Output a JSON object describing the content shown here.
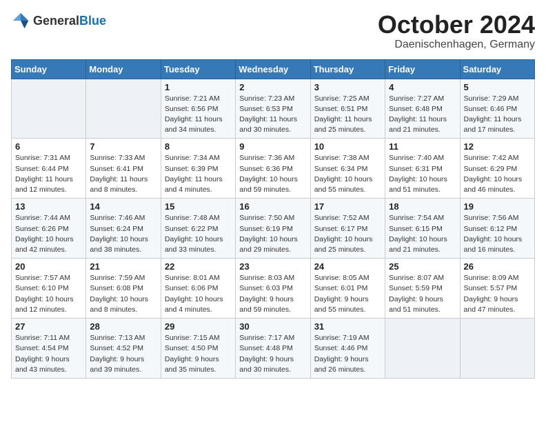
{
  "header": {
    "logo_general": "General",
    "logo_blue": "Blue",
    "month": "October 2024",
    "location": "Daenischenhagen, Germany"
  },
  "weekdays": [
    "Sunday",
    "Monday",
    "Tuesday",
    "Wednesday",
    "Thursday",
    "Friday",
    "Saturday"
  ],
  "weeks": [
    [
      {
        "day": "",
        "info": ""
      },
      {
        "day": "",
        "info": ""
      },
      {
        "day": "1",
        "info": "Sunrise: 7:21 AM\nSunset: 6:56 PM\nDaylight: 11 hours\nand 34 minutes."
      },
      {
        "day": "2",
        "info": "Sunrise: 7:23 AM\nSunset: 6:53 PM\nDaylight: 11 hours\nand 30 minutes."
      },
      {
        "day": "3",
        "info": "Sunrise: 7:25 AM\nSunset: 6:51 PM\nDaylight: 11 hours\nand 25 minutes."
      },
      {
        "day": "4",
        "info": "Sunrise: 7:27 AM\nSunset: 6:48 PM\nDaylight: 11 hours\nand 21 minutes."
      },
      {
        "day": "5",
        "info": "Sunrise: 7:29 AM\nSunset: 6:46 PM\nDaylight: 11 hours\nand 17 minutes."
      }
    ],
    [
      {
        "day": "6",
        "info": "Sunrise: 7:31 AM\nSunset: 6:44 PM\nDaylight: 11 hours\nand 12 minutes."
      },
      {
        "day": "7",
        "info": "Sunrise: 7:33 AM\nSunset: 6:41 PM\nDaylight: 11 hours\nand 8 minutes."
      },
      {
        "day": "8",
        "info": "Sunrise: 7:34 AM\nSunset: 6:39 PM\nDaylight: 11 hours\nand 4 minutes."
      },
      {
        "day": "9",
        "info": "Sunrise: 7:36 AM\nSunset: 6:36 PM\nDaylight: 10 hours\nand 59 minutes."
      },
      {
        "day": "10",
        "info": "Sunrise: 7:38 AM\nSunset: 6:34 PM\nDaylight: 10 hours\nand 55 minutes."
      },
      {
        "day": "11",
        "info": "Sunrise: 7:40 AM\nSunset: 6:31 PM\nDaylight: 10 hours\nand 51 minutes."
      },
      {
        "day": "12",
        "info": "Sunrise: 7:42 AM\nSunset: 6:29 PM\nDaylight: 10 hours\nand 46 minutes."
      }
    ],
    [
      {
        "day": "13",
        "info": "Sunrise: 7:44 AM\nSunset: 6:26 PM\nDaylight: 10 hours\nand 42 minutes."
      },
      {
        "day": "14",
        "info": "Sunrise: 7:46 AM\nSunset: 6:24 PM\nDaylight: 10 hours\nand 38 minutes."
      },
      {
        "day": "15",
        "info": "Sunrise: 7:48 AM\nSunset: 6:22 PM\nDaylight: 10 hours\nand 33 minutes."
      },
      {
        "day": "16",
        "info": "Sunrise: 7:50 AM\nSunset: 6:19 PM\nDaylight: 10 hours\nand 29 minutes."
      },
      {
        "day": "17",
        "info": "Sunrise: 7:52 AM\nSunset: 6:17 PM\nDaylight: 10 hours\nand 25 minutes."
      },
      {
        "day": "18",
        "info": "Sunrise: 7:54 AM\nSunset: 6:15 PM\nDaylight: 10 hours\nand 21 minutes."
      },
      {
        "day": "19",
        "info": "Sunrise: 7:56 AM\nSunset: 6:12 PM\nDaylight: 10 hours\nand 16 minutes."
      }
    ],
    [
      {
        "day": "20",
        "info": "Sunrise: 7:57 AM\nSunset: 6:10 PM\nDaylight: 10 hours\nand 12 minutes."
      },
      {
        "day": "21",
        "info": "Sunrise: 7:59 AM\nSunset: 6:08 PM\nDaylight: 10 hours\nand 8 minutes."
      },
      {
        "day": "22",
        "info": "Sunrise: 8:01 AM\nSunset: 6:06 PM\nDaylight: 10 hours\nand 4 minutes."
      },
      {
        "day": "23",
        "info": "Sunrise: 8:03 AM\nSunset: 6:03 PM\nDaylight: 9 hours\nand 59 minutes."
      },
      {
        "day": "24",
        "info": "Sunrise: 8:05 AM\nSunset: 6:01 PM\nDaylight: 9 hours\nand 55 minutes."
      },
      {
        "day": "25",
        "info": "Sunrise: 8:07 AM\nSunset: 5:59 PM\nDaylight: 9 hours\nand 51 minutes."
      },
      {
        "day": "26",
        "info": "Sunrise: 8:09 AM\nSunset: 5:57 PM\nDaylight: 9 hours\nand 47 minutes."
      }
    ],
    [
      {
        "day": "27",
        "info": "Sunrise: 7:11 AM\nSunset: 4:54 PM\nDaylight: 9 hours\nand 43 minutes."
      },
      {
        "day": "28",
        "info": "Sunrise: 7:13 AM\nSunset: 4:52 PM\nDaylight: 9 hours\nand 39 minutes."
      },
      {
        "day": "29",
        "info": "Sunrise: 7:15 AM\nSunset: 4:50 PM\nDaylight: 9 hours\nand 35 minutes."
      },
      {
        "day": "30",
        "info": "Sunrise: 7:17 AM\nSunset: 4:48 PM\nDaylight: 9 hours\nand 30 minutes."
      },
      {
        "day": "31",
        "info": "Sunrise: 7:19 AM\nSunset: 4:46 PM\nDaylight: 9 hours\nand 26 minutes."
      },
      {
        "day": "",
        "info": ""
      },
      {
        "day": "",
        "info": ""
      }
    ]
  ]
}
